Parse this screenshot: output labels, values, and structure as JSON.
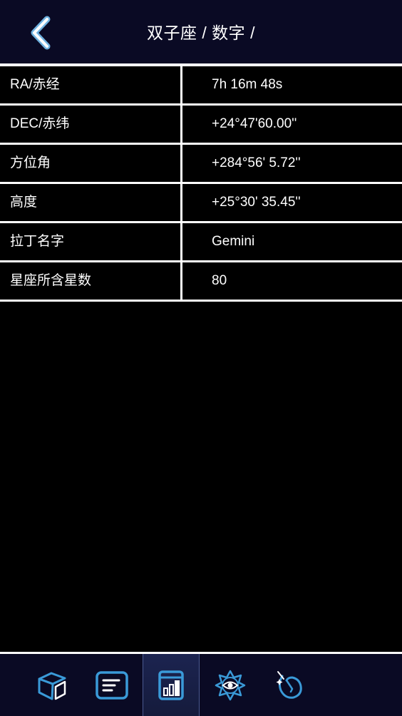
{
  "header": {
    "title": "双子座 / 数字 /",
    "back_icon": "chevron-left-icon"
  },
  "table": {
    "rows": [
      {
        "label": "RA/赤经",
        "value": "7h 16m 48s"
      },
      {
        "label": "DEC/赤纬",
        "value": "+24°47'60.00''"
      },
      {
        "label": "方位角",
        "value": "+284°56' 5.72''"
      },
      {
        "label": "高度",
        "value": "+25°30' 35.45''"
      },
      {
        "label": "拉丁名字",
        "value": "Gemini"
      },
      {
        "label": "星座所含星数",
        "value": "80"
      }
    ]
  },
  "bottom_nav": {
    "tabs": [
      {
        "icon": "cube-icon",
        "active": false
      },
      {
        "icon": "text-list-icon",
        "active": false
      },
      {
        "icon": "bar-chart-icon",
        "active": true
      },
      {
        "icon": "eye-star-icon",
        "active": false
      },
      {
        "icon": "unicorn-icon",
        "active": false
      }
    ]
  },
  "colors": {
    "background": "#000000",
    "bar_background": "#0a0a24",
    "accent": "#3a9ad8",
    "divider": "#ffffff"
  }
}
